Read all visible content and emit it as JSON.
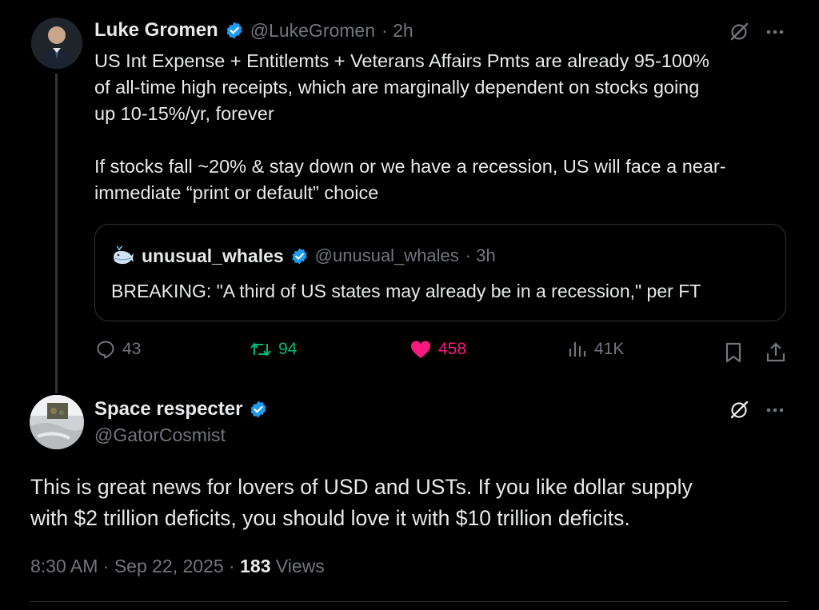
{
  "post": {
    "author_name": "Luke Gromen",
    "handle": "@LukeGromen",
    "time": "· 2h",
    "text_lines": [
      "US Int Expense + Entitlemts + Veterans Affairs Pmts are already 95-100%",
      "of all-time high receipts, which are marginally dependent on stocks going",
      "up 10-15%/yr, forever",
      "",
      "If stocks fall ~20% & stay down or we have a recession, US will face a near-",
      "immediate “print or default” choice"
    ],
    "quote": {
      "author_name": "unusual_whales",
      "handle": "@unusual_whales",
      "time": "· 3h",
      "text": "BREAKING: \"A third of US states may already be in a recession,\" per FT"
    },
    "actions": {
      "replies": "43",
      "reposts": "94",
      "likes": "458",
      "views": "41K"
    }
  },
  "reply": {
    "author_name": "Space respecter",
    "handle": "@GatorCosmist",
    "text_lines": [
      "This is great news for lovers of USD and USTs. If you like dollar supply",
      "with $2 trillion deficits, you should love it with $10 trillion deficits."
    ],
    "time": "8:30 AM · Sep 22, 2025 ·",
    "views_count": "183",
    "views_label": "Views"
  },
  "colors": {
    "verified": "#1d9bf0",
    "repost": "#00ba7c",
    "like": "#f91880",
    "muted": "#71767b"
  },
  "icons": {
    "grok": "grok-icon",
    "more": "more-icon",
    "reply": "reply-icon",
    "repost": "repost-icon",
    "like": "heart-icon",
    "views": "views-icon",
    "bookmark": "bookmark-icon",
    "share": "share-icon"
  }
}
